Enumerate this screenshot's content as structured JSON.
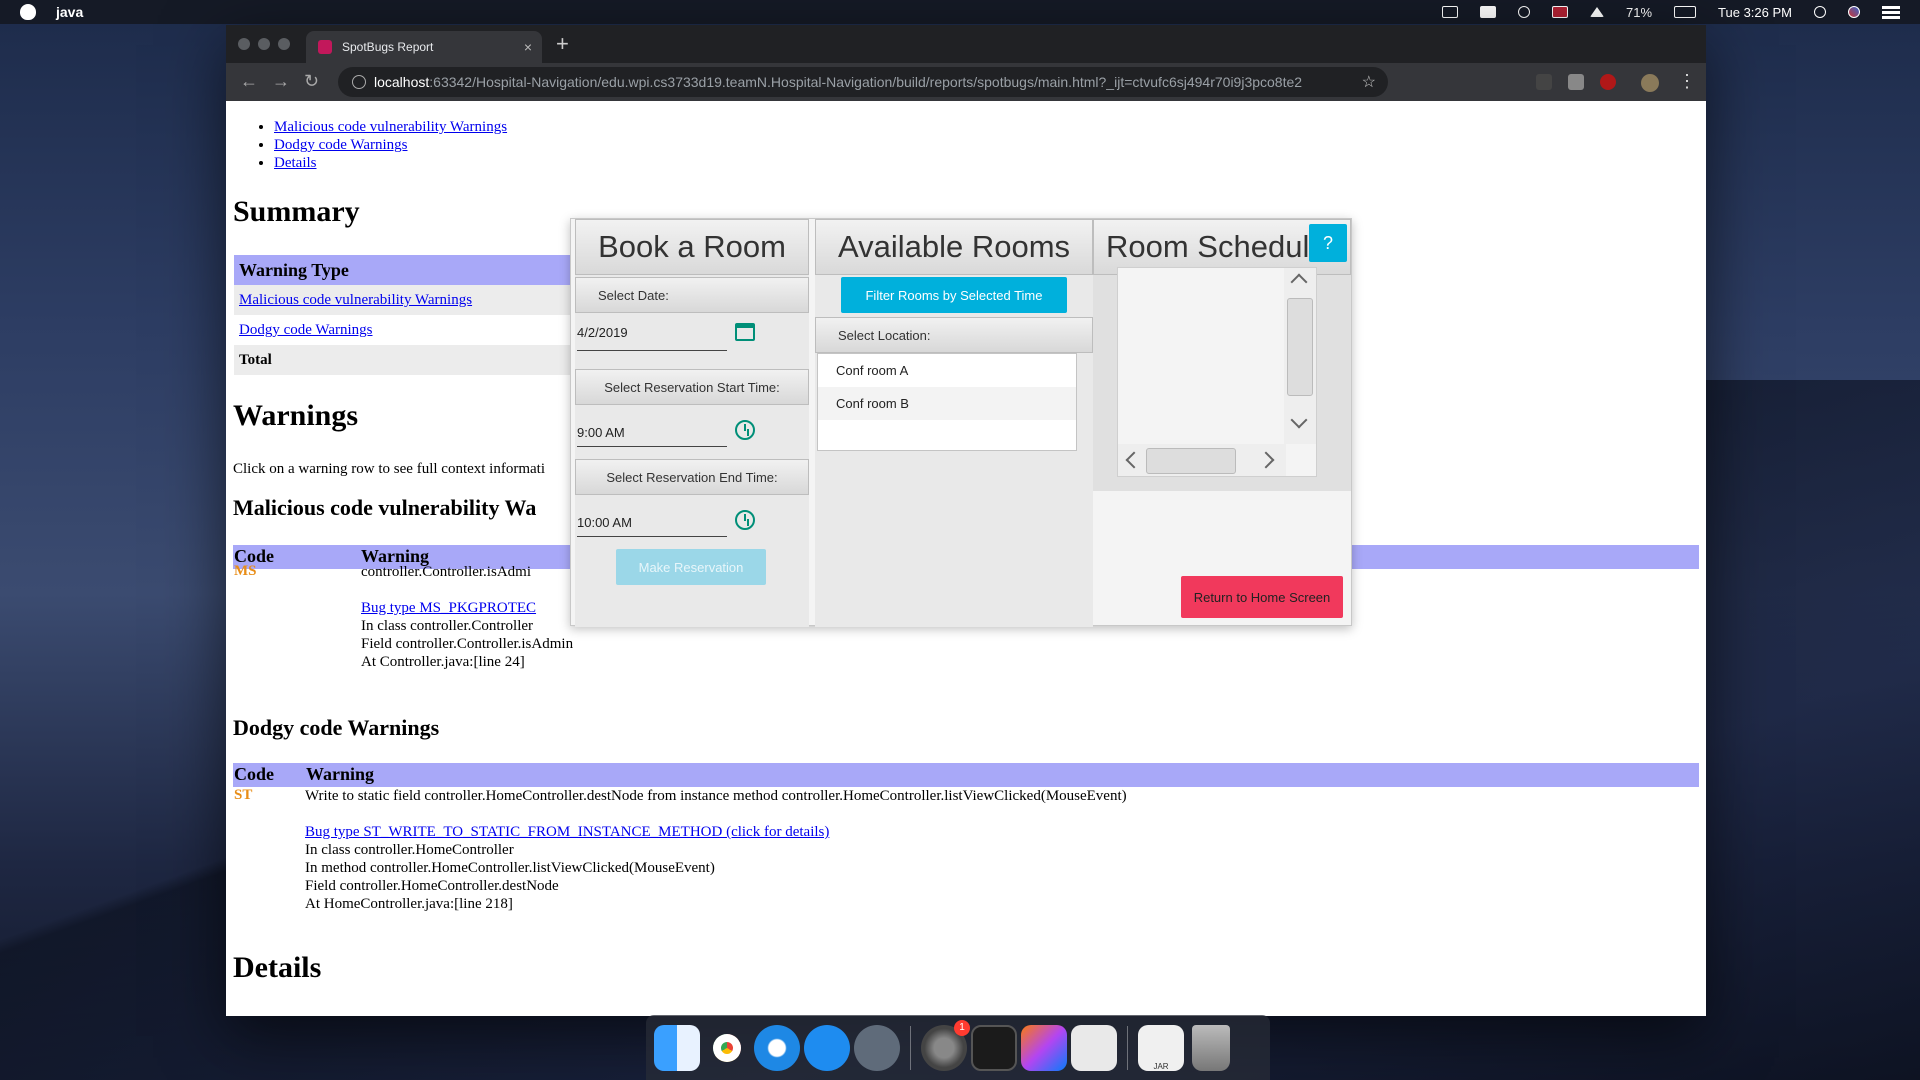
{
  "menubar": {
    "app": "java",
    "battery": "71%",
    "clock": "Tue 3:26 PM"
  },
  "browser": {
    "tab_title": "SpotBugs Report",
    "tab_close": "×",
    "new_tab": "+",
    "url_host": "localhost",
    "url_rest": ":63342/Hospital-Navigation/edu.wpi.cs3733d19.teamN.Hospital-Navigation/build/reports/spotbugs/main.html?_ijt=ctvufc6sj494r70i9j3pco8te2",
    "nav_back": "←",
    "nav_forward": "→",
    "nav_reload": "↻",
    "bookmark": "☆",
    "menu": "⋮"
  },
  "report": {
    "nav_links": [
      "Malicious code vulnerability Warnings",
      "Dodgy code Warnings",
      "Details"
    ],
    "summary_heading": "Summary",
    "summary_table": {
      "header": "Warning Type",
      "rows": [
        "Malicious code vulnerability Warnings",
        "Dodgy code Warnings"
      ],
      "total": "Total"
    },
    "warnings_heading": "Warnings",
    "warnings_intro": "Click on a warning row to see full context informati",
    "malicious_heading": "Malicious code vulnerability Wa",
    "col_code": "Code",
    "col_warning": "Warning",
    "malicious": {
      "code": "MS",
      "summary": "controller.Controller.isAdmi",
      "bug_link": "Bug type MS_PKGPROTEC",
      "lines": [
        "In class controller.Controller",
        "Field controller.Controller.isAdmin",
        "At Controller.java:[line 24]"
      ]
    },
    "dodgy_heading": "Dodgy code Warnings",
    "dodgy": {
      "code": "ST",
      "summary": "Write to static field controller.HomeController.destNode from instance method controller.HomeController.listViewClicked(MouseEvent)",
      "bug_link": "Bug type ST_WRITE_TO_STATIC_FROM_INSTANCE_METHOD (click for details)",
      "lines": [
        "In class controller.HomeController",
        "In method controller.HomeController.listViewClicked(MouseEvent)",
        "Field controller.HomeController.destNode",
        "At HomeController.java:[line 218]"
      ]
    },
    "details_heading": "Details"
  },
  "app": {
    "book_title": "Book a Room",
    "select_date_label": "Select Date:",
    "date_value": "4/2/2019",
    "start_label": "Select Reservation Start Time:",
    "start_value": "9:00 AM",
    "end_label": "Select Reservation End Time:",
    "end_value": "10:00 AM",
    "make_reservation": "Make Reservation",
    "available_title": "Available Rooms",
    "filter_button": "Filter Rooms by Selected Time",
    "location_label": "Select Location:",
    "rooms": [
      "Conf room A",
      "Conf room B"
    ],
    "schedule_title": "Room Schedul",
    "help_button": "?",
    "return_button": "Return to Home Screen",
    "colors": {
      "accent": "#00b0dc",
      "danger": "#f1395c",
      "icon": "#008f78"
    }
  },
  "dock": {
    "icons": [
      "finder-icon",
      "chrome-icon",
      "safari-icon",
      "app-store-icon",
      "launchpad-icon",
      "system-preferences-icon",
      "activity-monitor-icon",
      "intellij-icon",
      "java-app-icon",
      "jar-file-icon",
      "trash-icon"
    ],
    "sysprefs_badge": "1",
    "jar_label": "JAR"
  }
}
